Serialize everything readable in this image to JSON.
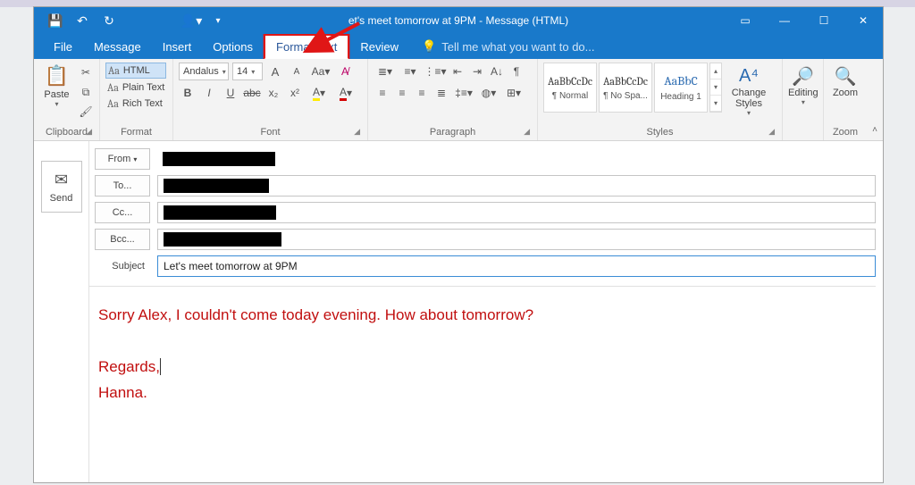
{
  "titlebar": {
    "title_suffix": "et's meet tomorrow at 9PM - Message (HTML)"
  },
  "tabs": {
    "file": "File",
    "message": "Message",
    "insert": "Insert",
    "options": "Options",
    "format_text": "Format Text",
    "review": "Review",
    "tellme": "Tell me what you want to do..."
  },
  "ribbon": {
    "clipboard": {
      "label": "Clipboard",
      "paste": "Paste"
    },
    "format": {
      "label": "Format",
      "html": "Aa HTML",
      "plain": "Aa Plain Text",
      "rich": "Aa Rich Text"
    },
    "font": {
      "label": "Font",
      "name": "Andalus",
      "size": "14"
    },
    "paragraph": {
      "label": "Paragraph"
    },
    "styles": {
      "label": "Styles",
      "s1_prev": "AaBbCcDc",
      "s1_name": "¶ Normal",
      "s2_prev": "AaBbCcDc",
      "s2_name": "¶ No Spa...",
      "s3_prev": "AaBbC",
      "s3_name": "Heading 1",
      "change": "Change Styles"
    },
    "editing": {
      "label": "Editing"
    },
    "zoom": {
      "label": "Zoom",
      "btn": "Zoom"
    }
  },
  "compose": {
    "send": "Send",
    "from_label": "From",
    "to_label": "To...",
    "cc_label": "Cc...",
    "bcc_label": "Bcc...",
    "subject_label": "Subject",
    "subject_value": "Let's meet tomorrow at 9PM",
    "body_line1": "Sorry Alex, I couldn't come today evening. How about tomorrow?",
    "body_regards": "Regards,",
    "body_sign": "Hanna."
  }
}
